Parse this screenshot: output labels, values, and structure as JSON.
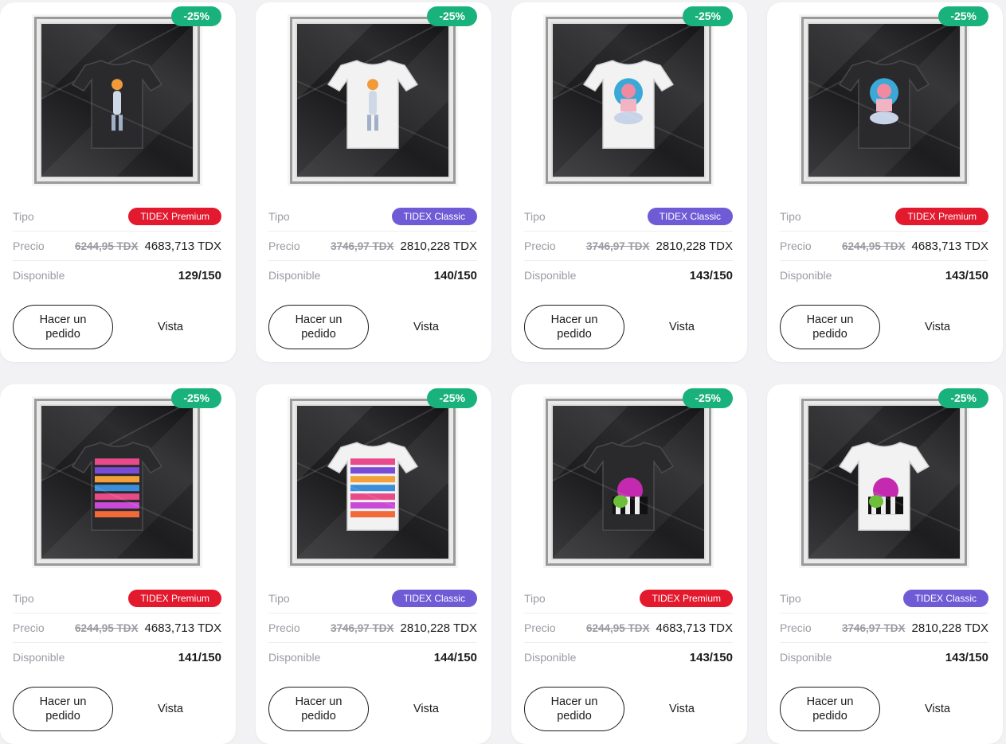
{
  "labels": {
    "type": "Tipo",
    "price": "Precio",
    "available": "Disponible",
    "order_button": "Hacer un pedido",
    "view_button": "Vista"
  },
  "colors": {
    "premium": "#e3192e",
    "classic": "#6f5bd6",
    "discount": "#19b27c"
  },
  "products": [
    {
      "discount": "-25%",
      "type": "TIDEX Premium",
      "tier": "premium",
      "old_price": "6244,95 TDX",
      "price": "4683,713 TDX",
      "available": "129/150",
      "shirt_color": "dark",
      "design": "astronaut"
    },
    {
      "discount": "-25%",
      "type": "TIDEX Classic",
      "tier": "classic",
      "old_price": "3746,97 TDX",
      "price": "2810,228 TDX",
      "available": "140/150",
      "shirt_color": "white",
      "design": "astronaut"
    },
    {
      "discount": "-25%",
      "type": "TIDEX Classic",
      "tier": "classic",
      "old_price": "3746,97 TDX",
      "price": "2810,228 TDX",
      "available": "143/150",
      "shirt_color": "white",
      "design": "portrait"
    },
    {
      "discount": "-25%",
      "type": "TIDEX Premium",
      "tier": "premium",
      "old_price": "6244,95 TDX",
      "price": "4683,713 TDX",
      "available": "143/150",
      "shirt_color": "dark",
      "design": "portrait"
    },
    {
      "discount": "-25%",
      "type": "TIDEX Premium",
      "tier": "premium",
      "old_price": "6244,95 TDX",
      "price": "4683,713 TDX",
      "available": "141/150",
      "shirt_color": "dark",
      "design": "stripes"
    },
    {
      "discount": "-25%",
      "type": "TIDEX Classic",
      "tier": "classic",
      "old_price": "3746,97 TDX",
      "price": "2810,228 TDX",
      "available": "144/150",
      "shirt_color": "white",
      "design": "stripes"
    },
    {
      "discount": "-25%",
      "type": "TIDEX Premium",
      "tier": "premium",
      "old_price": "6244,95 TDX",
      "price": "4683,713 TDX",
      "available": "143/150",
      "shirt_color": "dark",
      "design": "frog"
    },
    {
      "discount": "-25%",
      "type": "TIDEX Classic",
      "tier": "classic",
      "old_price": "3746,97 TDX",
      "price": "2810,228 TDX",
      "available": "143/150",
      "shirt_color": "white",
      "design": "frog"
    }
  ]
}
